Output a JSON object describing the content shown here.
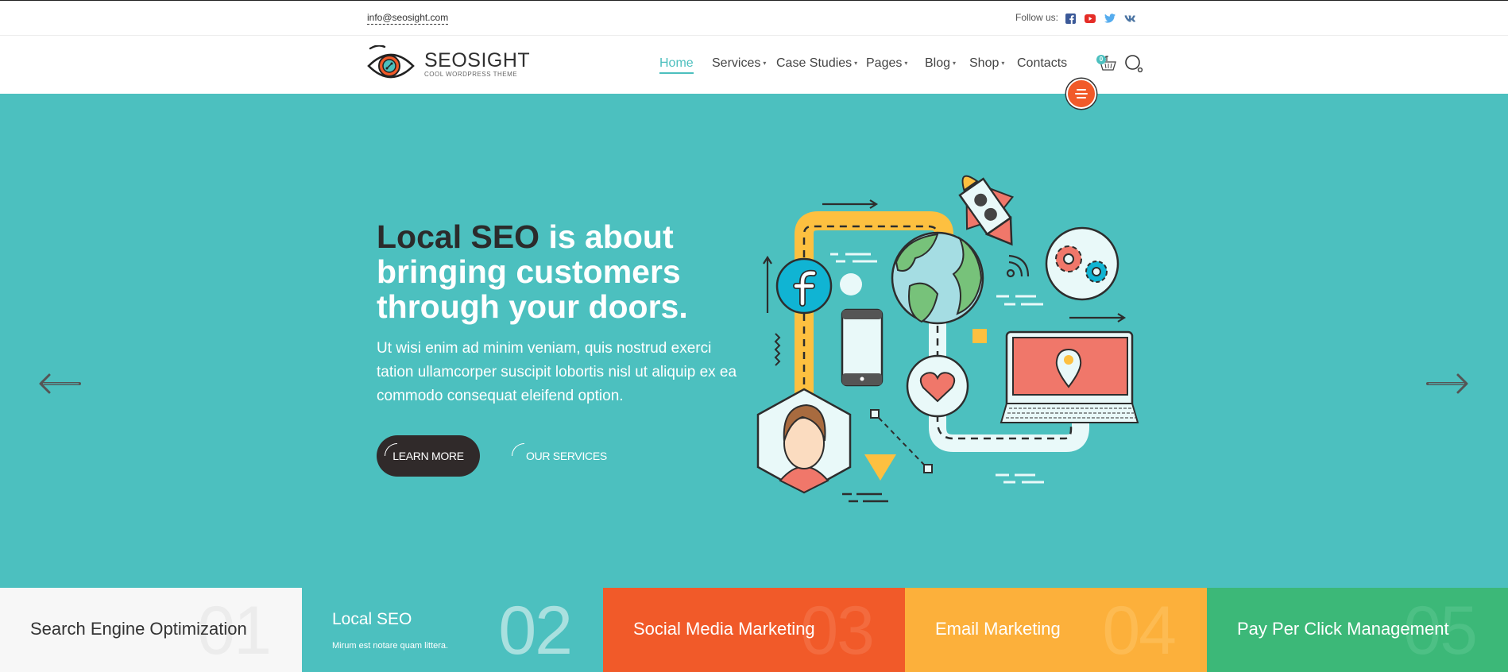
{
  "topbar": {
    "email": "info@seosight.com",
    "follow_label": "Follow us:",
    "social": [
      {
        "name": "facebook",
        "icon": "facebook-icon",
        "color": "#3b5998"
      },
      {
        "name": "youtube",
        "icon": "youtube-icon",
        "color": "#e52d27"
      },
      {
        "name": "twitter",
        "icon": "twitter-icon",
        "color": "#55acee"
      },
      {
        "name": "vk",
        "icon": "vk-icon",
        "color": "#4c75a3"
      }
    ]
  },
  "header": {
    "logo_title": "SEOSIGHT",
    "logo_subtitle": "COOL WORDPRESS THEME",
    "nav": [
      {
        "label": "Home",
        "active": true,
        "dropdown": false
      },
      {
        "label": "Services",
        "dropdown": true
      },
      {
        "label": "Case Studies",
        "dropdown": true
      },
      {
        "label": "Pages",
        "dropdown": true
      },
      {
        "label": "Blog",
        "dropdown": true
      },
      {
        "label": "Shop",
        "dropdown": true
      },
      {
        "label": "Contacts",
        "dropdown": false
      }
    ],
    "cart_count": "0",
    "caret": "▾"
  },
  "hero": {
    "headline_dark": "Local SEO",
    "headline_rest": " is about bringing customers through your doors.",
    "paragraph": "Ut wisi enim ad minim veniam, quis nostrud exerci tation ullamcorper suscipit lobortis nisl ut aliquip ex ea commodo consequat eleifend option.",
    "primary_button": "LEARN MORE",
    "secondary_button": "OUR SERVICES"
  },
  "features": [
    {
      "number": "01",
      "title": "Search Engine Optimization",
      "subtitle": "",
      "bg": "#f7f7f7",
      "color": "#333333",
      "num_color": "#ececec"
    },
    {
      "number": "02",
      "title": "Local SEO",
      "subtitle": "Mirum est notare quam littera.",
      "bg": "#4cc0bf",
      "color": "#ffffff",
      "num_color": "#a9e0df"
    },
    {
      "number": "03",
      "title": "Social Media Marketing",
      "subtitle": "",
      "bg": "#f15a29",
      "color": "#ffffff",
      "num_color": "#f36b3e"
    },
    {
      "number": "04",
      "title": "Email Marketing",
      "subtitle": "",
      "bg": "#fcb03b",
      "color": "#ffffff",
      "num_color": "#fdbb52"
    },
    {
      "number": "05",
      "title": "Pay Per Click Management",
      "subtitle": "",
      "bg": "#3cb878",
      "color": "#ffffff",
      "num_color": "#4dc085"
    }
  ],
  "colors": {
    "accent": "#4cc0bf",
    "dark": "#302a2a",
    "orange": "#f15a29"
  }
}
